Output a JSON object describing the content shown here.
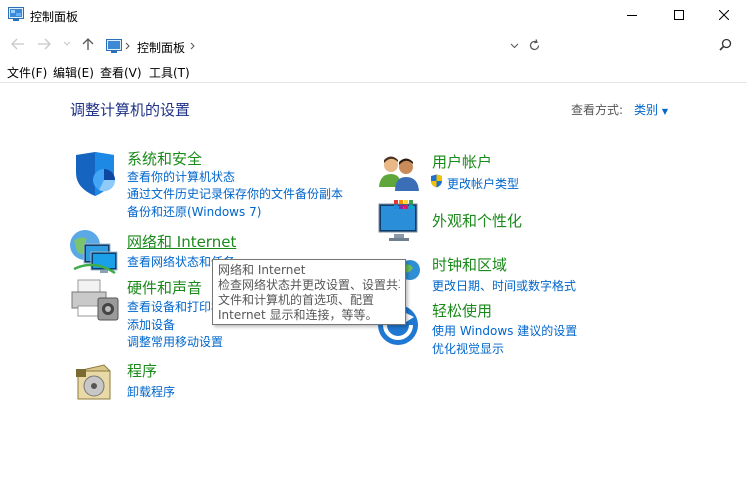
{
  "window": {
    "title": "控制面板",
    "minimize_icon": "minimize-icon",
    "maximize_icon": "maximize-icon",
    "close_icon": "close-icon"
  },
  "nav": {
    "breadcrumb": "控制面板",
    "back_icon": "back-arrow-icon",
    "forward_icon": "forward-arrow-icon",
    "up_icon": "up-arrow-icon"
  },
  "menu": {
    "file": "文件(F)",
    "edit": "编辑(E)",
    "view": "查看(V)",
    "tools": "工具(T)"
  },
  "main": {
    "title": "调整计算机的设置",
    "view_by_label": "查看方式:",
    "view_by_value": "类别"
  },
  "categories": {
    "system": {
      "title": "系统和安全",
      "links": [
        "查看你的计算机状态",
        "通过文件历史记录保存你的文件备份副本",
        "备份和还原(Windows 7)"
      ]
    },
    "network": {
      "title": "网络和 Internet",
      "links": [
        "查看网络状态和任务"
      ]
    },
    "hardware": {
      "title": "硬件和声音",
      "links": [
        "查看设备和打印机",
        "添加设备",
        "调整常用移动设置"
      ]
    },
    "programs": {
      "title": "程序",
      "links": [
        "卸载程序"
      ]
    },
    "user": {
      "title": "用户帐户",
      "links": [
        "更改帐户类型"
      ]
    },
    "appearance": {
      "title": "外观和个性化",
      "links": []
    },
    "clock": {
      "title": "时钟和区域",
      "links": [
        "更改日期、时间或数字格式"
      ]
    },
    "ease": {
      "title": "轻松使用",
      "links": [
        "使用 Windows 建议的设置",
        "优化视觉显示"
      ]
    }
  },
  "tooltip": {
    "lines": [
      "网络和 Internet",
      "检查网络状态并更改设置、设置共享",
      "文件和计算机的首选项、配置",
      "Internet 显示和连接，等等。"
    ]
  },
  "colors": {
    "category_title": "#1a8a1a",
    "link": "#0066cc",
    "page_title": "#1e3287"
  }
}
